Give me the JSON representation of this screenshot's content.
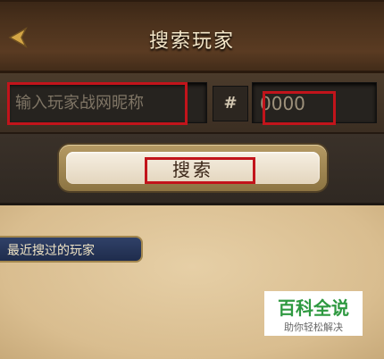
{
  "header": {
    "title": "搜索玩家",
    "back_icon": "left-arrow-icon"
  },
  "search_form": {
    "name_placeholder": "输入玩家战网昵称",
    "hash_symbol": "#",
    "number_value": "0000",
    "search_button": "搜索"
  },
  "recent_section": {
    "label": "最近搜过的玩家"
  },
  "watermark": {
    "main": "百科全说",
    "sub": "助你轻松解决"
  },
  "colors": {
    "highlight": "#c2141b",
    "accent": "#a3874e"
  }
}
